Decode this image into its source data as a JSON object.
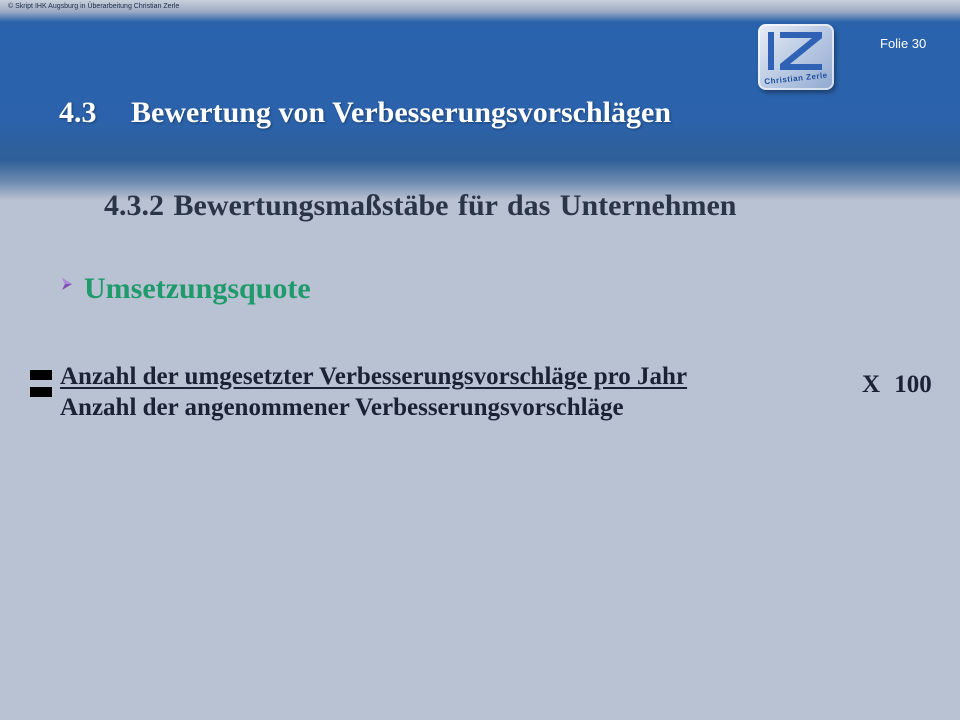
{
  "header": {
    "copyright": "© Skript IHK Augsburg in Überarbeitung  Christian Zerle",
    "slide_number": "Folie 30",
    "logo_text": "Christian Zerle",
    "title_number": "4.3",
    "title_text": "Bewertung von Verbesserungsvorschlägen"
  },
  "content": {
    "subtitle": "4.3.2  Bewertungsmaßstäbe für  das Unternehmen",
    "bullet": {
      "icon": "arrow-bullet-icon",
      "text": "Umsetzungsquote"
    },
    "formula": {
      "equals_icon": "equals-sign-icon",
      "numerator": "Anzahl der umgesetzter Verbesserungsvorschläge pro Jahr",
      "denominator": "Anzahl der angenommener Verbesserungsvorschläge",
      "multiplier": "X  100"
    }
  },
  "colors": {
    "header_blue": "#2a63ad",
    "background": "#b9c2d3",
    "bullet_green": "#1f9a6a",
    "bullet_arrow": "#7d4fb6",
    "text_dark": "#1c2236"
  }
}
